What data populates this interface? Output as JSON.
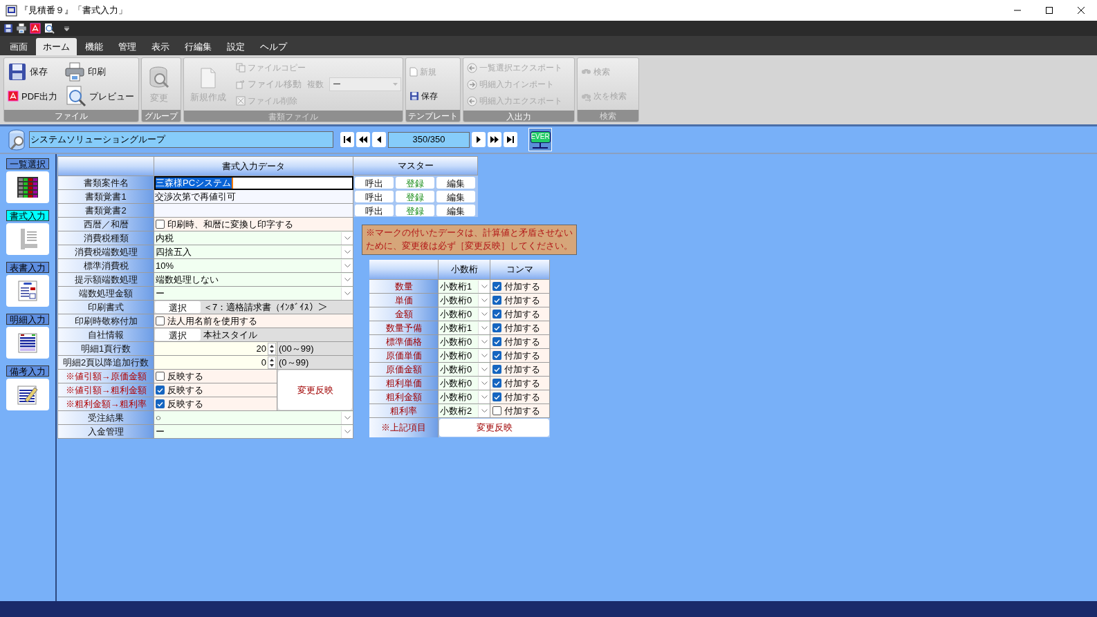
{
  "window": {
    "title": "『見積番９』「書式入力」"
  },
  "menu_tabs": [
    {
      "label": "画面",
      "selected": false
    },
    {
      "label": "ホーム",
      "selected": true
    },
    {
      "label": "機能",
      "selected": false
    },
    {
      "label": "管理",
      "selected": false
    },
    {
      "label": "表示",
      "selected": false
    },
    {
      "label": "行編集",
      "selected": false
    },
    {
      "label": "設定",
      "selected": false
    },
    {
      "label": "ヘルプ",
      "selected": false
    }
  ],
  "ribbon": [
    {
      "label": "ファイル",
      "disabled": false,
      "columns": [
        [
          {
            "kind": "medium",
            "label": "保存",
            "disabled": false
          },
          {
            "kind": "medium",
            "label": "PDF出力",
            "disabled": false
          }
        ],
        [
          {
            "kind": "medium",
            "label": "印刷",
            "disabled": false
          },
          {
            "kind": "medium",
            "label": "プレビュー",
            "disabled": false
          }
        ]
      ]
    },
    {
      "label": "グループ",
      "disabled": false,
      "columns": [
        [
          {
            "kind": "large",
            "label": "変更",
            "disabled": true
          }
        ]
      ]
    },
    {
      "label": "書類ファイル",
      "disabled": true,
      "columns": [
        [
          {
            "kind": "large",
            "label": "新規作成",
            "disabled": true
          }
        ],
        [
          {
            "kind": "small",
            "label": "ファイルコピー",
            "disabled": true
          },
          {
            "kind": "combo",
            "label": "ファイル移動",
            "field_label": "複数",
            "value": "ー",
            "disabled": true
          },
          {
            "kind": "small",
            "label": "ファイル削除",
            "disabled": true
          }
        ]
      ]
    },
    {
      "label": "テンプレート",
      "disabled": false,
      "columns": [
        [
          {
            "kind": "small",
            "label": "新規",
            "disabled": true
          },
          {
            "kind": "small",
            "label": "保存",
            "disabled": false
          }
        ]
      ]
    },
    {
      "label": "入出力",
      "disabled": false,
      "columns": [
        [
          {
            "kind": "small",
            "label": "一覧選択エクスポート",
            "disabled": true
          },
          {
            "kind": "small",
            "label": "明細入力インポート",
            "disabled": true
          },
          {
            "kind": "small",
            "label": "明細入力エクスポート",
            "disabled": true
          }
        ]
      ]
    },
    {
      "label": "検索",
      "disabled": true,
      "columns": [
        [
          {
            "kind": "small",
            "label": "検索",
            "disabled": true
          },
          {
            "kind": "small",
            "label": "次を検索",
            "disabled": true
          }
        ]
      ]
    }
  ],
  "nav": {
    "group_field": "システムソリューショングループ",
    "record": "350/350",
    "badge": "EVER"
  },
  "sidebar": [
    {
      "label": "一覧選択",
      "selected": false
    },
    {
      "label": "書式入力",
      "selected": true
    },
    {
      "label": "表書入力",
      "selected": false
    },
    {
      "label": "明細入力",
      "selected": false
    },
    {
      "label": "備考入力",
      "selected": false
    }
  ],
  "form": {
    "header": "書式入力データ",
    "reflect_button": "変更反映",
    "rows": [
      {
        "label": "書類案件名",
        "alert": false,
        "kind": "text",
        "value": "三森様PCシステム",
        "focused": true
      },
      {
        "label": "書類覚書1",
        "alert": false,
        "kind": "text",
        "value": "交渉次第で再値引可",
        "focused": false
      },
      {
        "label": "書類覚書2",
        "alert": false,
        "kind": "text",
        "focused": false
      },
      {
        "label": "西暦／和暦",
        "alert": false,
        "kind": "check",
        "text": "印刷時、和暦に変換し印字する",
        "checked": false
      },
      {
        "label": "消費税種類",
        "alert": false,
        "kind": "select",
        "value": "内税"
      },
      {
        "label": "消費税端数処理",
        "alert": false,
        "kind": "select",
        "value": "四捨五入"
      },
      {
        "label": "標準消費税",
        "alert": false,
        "kind": "select",
        "value": "10%"
      },
      {
        "label": "提示額端数処理",
        "alert": false,
        "kind": "select",
        "value": "端数処理しない"
      },
      {
        "label": "端数処理金額",
        "alert": false,
        "kind": "select",
        "value": "ー"
      },
      {
        "label": "印刷書式",
        "alert": false,
        "kind": "pick",
        "button": "選択",
        "value": "＜7：適格請求書（ｲﾝﾎﾞｲｽ）＞"
      },
      {
        "label": "印刷時敬称付加",
        "alert": false,
        "kind": "check",
        "text": "法人用名前を使用する",
        "checked": false
      },
      {
        "label": "自社情報",
        "alert": false,
        "kind": "pick",
        "button": "選択",
        "value": "本社スタイル"
      },
      {
        "label": "明細1頁行数",
        "alert": false,
        "kind": "spin",
        "value": "20",
        "range": "(00～99)"
      },
      {
        "label": "明細2頁以降追加行数",
        "alert": false,
        "kind": "spin",
        "value": "0",
        "range": "(0～99)"
      },
      {
        "label": "※値引額→原価金額",
        "alert": true,
        "kind": "reflect",
        "text": "反映する",
        "checked": false
      },
      {
        "label": "※値引額→粗利金額",
        "alert": true,
        "kind": "reflect",
        "text": "反映する",
        "checked": true
      },
      {
        "label": "※粗利金額→粗利率",
        "alert": true,
        "kind": "reflect",
        "text": "反映する",
        "checked": true
      },
      {
        "label": "受注結果",
        "alert": false,
        "kind": "select",
        "value": "○"
      },
      {
        "label": "入金管理",
        "alert": false,
        "kind": "select",
        "value": "ー"
      }
    ]
  },
  "master": {
    "header": "マスター",
    "rows": [
      [
        {
          "label": "呼出",
          "kind": "call"
        },
        {
          "label": "登録",
          "kind": "register"
        },
        {
          "label": "編集",
          "kind": "edit"
        }
      ],
      [
        {
          "label": "呼出",
          "kind": "call"
        },
        {
          "label": "登録",
          "kind": "register"
        },
        {
          "label": "編集",
          "kind": "edit"
        }
      ],
      [
        {
          "label": "呼出",
          "kind": "call"
        },
        {
          "label": "登録",
          "kind": "register"
        },
        {
          "label": "編集",
          "kind": "edit"
        }
      ]
    ]
  },
  "note": {
    "lines": [
      "※マークの付いたデータは、計算値と矛盾させない",
      "ために、変更後は必ず［変更反映］してください。"
    ]
  },
  "digits": {
    "columns": [
      "小数桁",
      "コンマ"
    ],
    "footer_label": "※上記項目",
    "footer_button": "変更反映",
    "rows": [
      {
        "label": "数量",
        "digits": "小数桁1",
        "check_text": "付加する",
        "checked": true
      },
      {
        "label": "単価",
        "digits": "小数桁0",
        "check_text": "付加する",
        "checked": true
      },
      {
        "label": "金額",
        "digits": "小数桁0",
        "check_text": "付加する",
        "checked": true
      },
      {
        "label": "数量予備",
        "digits": "小数桁1",
        "check_text": "付加する",
        "checked": true
      },
      {
        "label": "標準価格",
        "digits": "小数桁0",
        "check_text": "付加する",
        "checked": true
      },
      {
        "label": "原価単価",
        "digits": "小数桁0",
        "check_text": "付加する",
        "checked": true
      },
      {
        "label": "原価金額",
        "digits": "小数桁0",
        "check_text": "付加する",
        "checked": true
      },
      {
        "label": "粗利単価",
        "digits": "小数桁0",
        "check_text": "付加する",
        "checked": true
      },
      {
        "label": "粗利金額",
        "digits": "小数桁0",
        "check_text": "付加する",
        "checked": true
      },
      {
        "label": "粗利率",
        "digits": "小数桁2",
        "check_text": "付加する",
        "checked": false
      }
    ]
  }
}
